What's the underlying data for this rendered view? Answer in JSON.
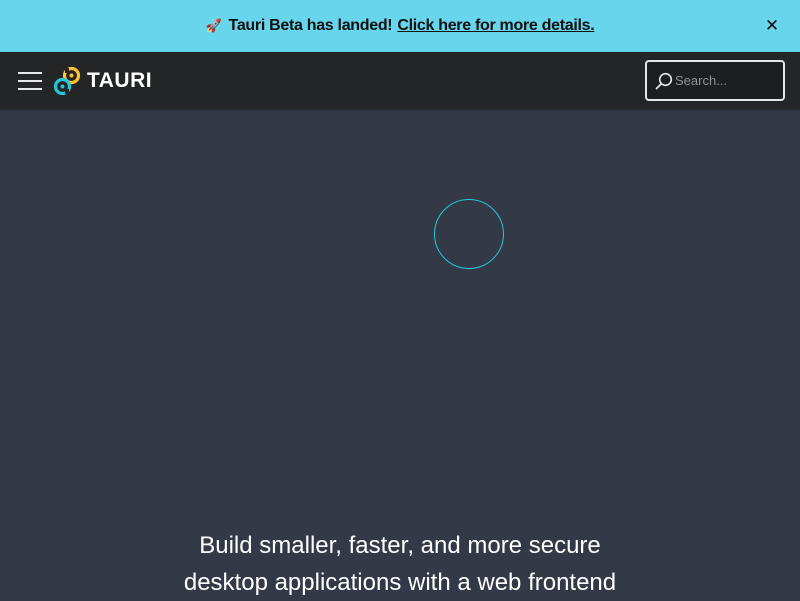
{
  "announcement": {
    "icon": "rocket-icon",
    "icon_glyph": "🚀",
    "text": "Tauri Beta has landed!",
    "link_text": "Click here for more details.",
    "close_glyph": "✕",
    "background": "#67d6ed"
  },
  "navbar": {
    "menu_icon": "hamburger-menu-icon",
    "logo_text": "TAURI",
    "search": {
      "placeholder": "Search...",
      "value": ""
    },
    "background": "#242526"
  },
  "hero": {
    "tagline_line1": "Build smaller, faster, and more secure",
    "tagline_line2": "desktop applications with a web frontend",
    "background": "#333947",
    "accent": "#24c8db"
  }
}
